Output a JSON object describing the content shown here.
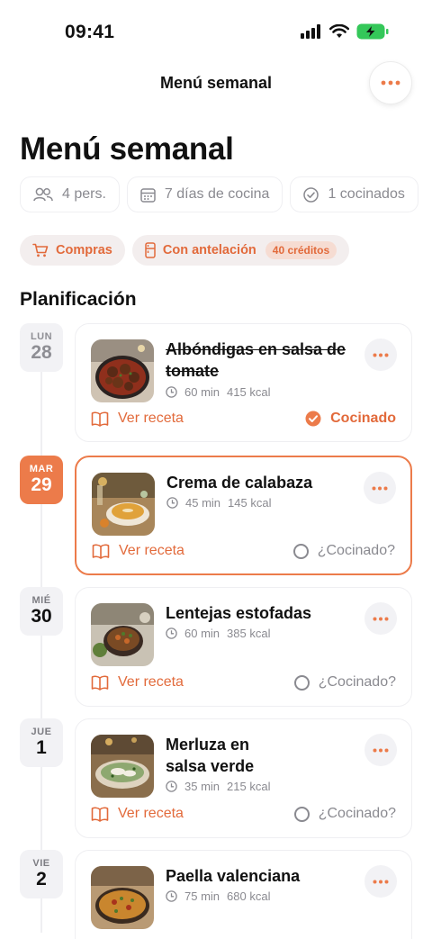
{
  "status_bar": {
    "time": "09:41"
  },
  "nav": {
    "title": "Menú semanal"
  },
  "page": {
    "title": "Menú semanal"
  },
  "stats": {
    "people": "4 pers.",
    "days": "7 días de cocina",
    "cooked": "1 cocinados"
  },
  "actions": {
    "shopping": "Compras",
    "prep": "Con antelación",
    "credits": "40 créditos"
  },
  "section": {
    "title": "Planificación"
  },
  "colors": {
    "accent": "#ec7b4a",
    "accent_text": "#e26a3b",
    "muted_bg": "#f2f2f5"
  },
  "days": [
    {
      "dow": "LUN",
      "num": "28",
      "dish": "Albóndigas en salsa de tomate",
      "time": "60 min",
      "kcal": "415 kcal",
      "recipe_label": "Ver receta",
      "status": "Cocinado"
    },
    {
      "dow": "MAR",
      "num": "29",
      "dish": "Crema de calabaza",
      "time": "45 min",
      "kcal": "145 kcal",
      "recipe_label": "Ver receta",
      "status": "¿Cocinado?"
    },
    {
      "dow": "MIÉ",
      "num": "30",
      "dish": "Lentejas estofadas",
      "time": "60 min",
      "kcal": "385 kcal",
      "recipe_label": "Ver receta",
      "status": "¿Cocinado?"
    },
    {
      "dow": "JUE",
      "num": "1",
      "dish": "Merluza en salsa verde",
      "time": "35 min",
      "kcal": "215 kcal",
      "recipe_label": "Ver receta",
      "status": "¿Cocinado?"
    },
    {
      "dow": "VIE",
      "num": "2",
      "dish": "Paella valenciana",
      "time": "75 min",
      "kcal": "680 kcal"
    }
  ]
}
